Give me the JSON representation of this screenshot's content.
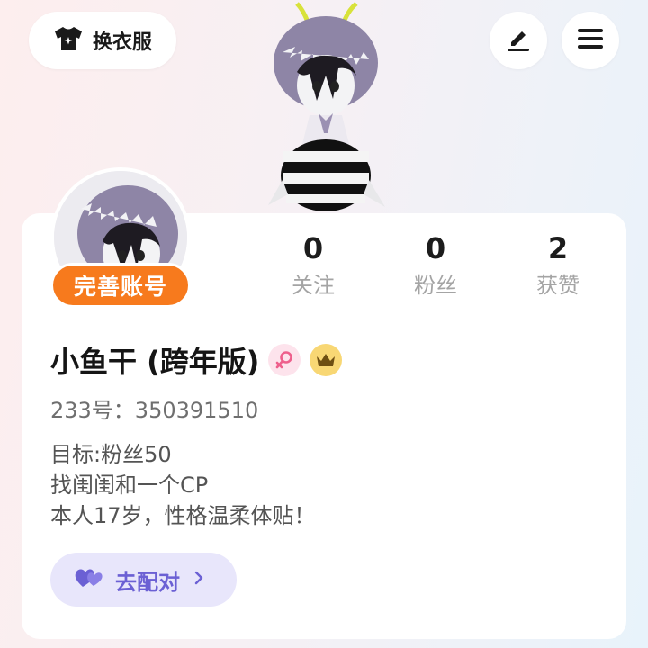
{
  "top_bar": {
    "dressup_label": "换衣服",
    "dressup_icon": "shirt-icon",
    "edit_icon": "pencil-icon",
    "menu_icon": "menu-icon"
  },
  "profile": {
    "complete_badge": "完善账号",
    "stats": [
      {
        "value": "0",
        "label": "关注"
      },
      {
        "value": "0",
        "label": "粉丝"
      },
      {
        "value": "2",
        "label": "获赞"
      }
    ],
    "name": "小鱼干 (跨年版)",
    "gender_icon": "female-icon",
    "vip_icon": "crown-icon",
    "uid": "233号：350391510",
    "bio": [
      "目标:粉丝50",
      "找闺闺和一个CP",
      "本人17岁，性格温柔体贴！"
    ],
    "match_label": "去配对",
    "match_icon": "hearts-icon",
    "colors": {
      "accent_orange": "#f77a1d",
      "accent_purple": "#6b60d4"
    }
  }
}
